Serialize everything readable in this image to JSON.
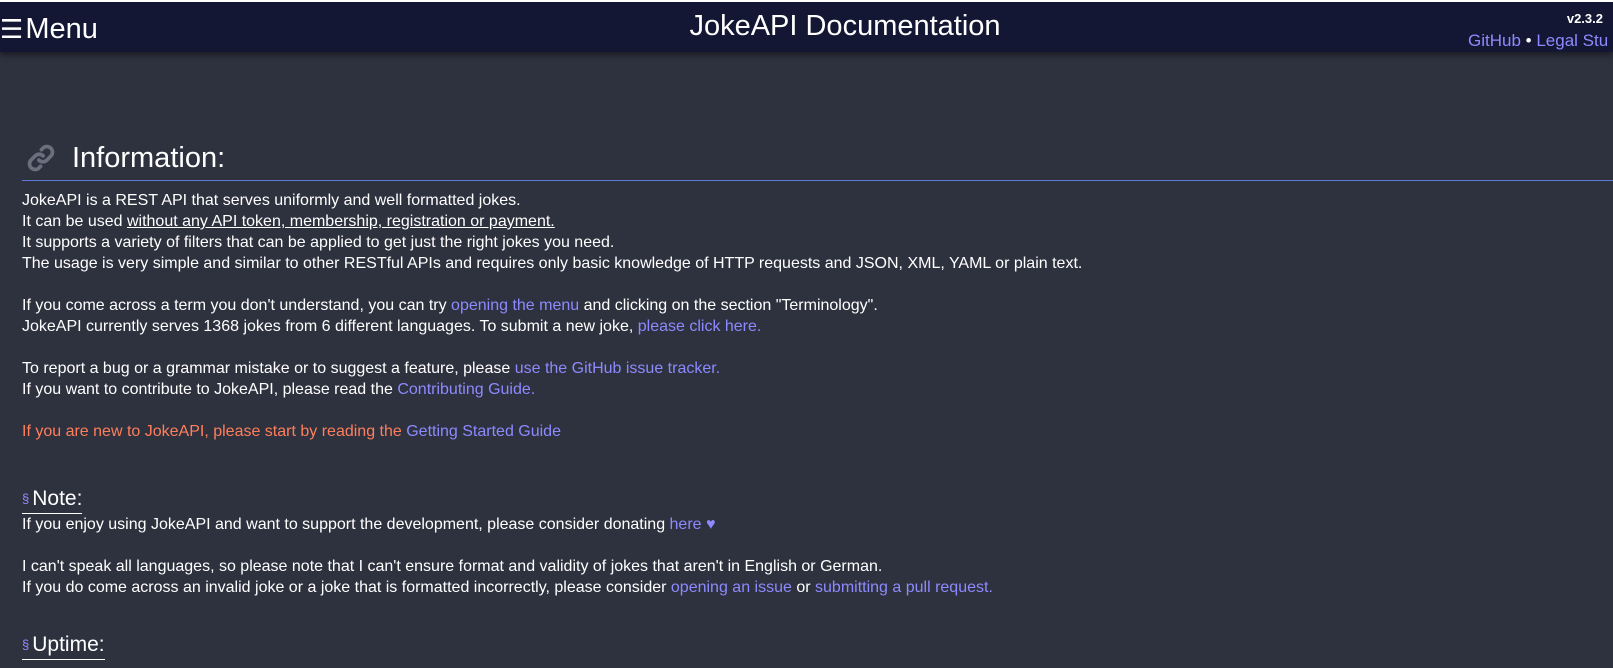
{
  "header": {
    "menu_icon": "☰",
    "menu_label": "Menu",
    "title": "JokeAPI Documentation",
    "version": "v2.3.2",
    "links": {
      "github": "GitHub",
      "separator": " • ",
      "legal": "Legal Stu"
    }
  },
  "information": {
    "title": "Information:",
    "icon": "link-icon",
    "lines": {
      "l1": "JokeAPI is a REST API that serves uniformly and well formatted jokes.",
      "l2_prefix": "It can be used ",
      "l2_underlined": "without any API token, membership, registration or payment.",
      "l3": "It supports a variety of filters that can be applied to get just the right jokes you need.",
      "l4": "The usage is very simple and similar to other RESTful APIs and requires only basic knowledge of HTTP requests and JSON, XML, YAML or plain text.",
      "l5_prefix": "If you come across a term you don't understand, you can try ",
      "l5_link": "opening the menu",
      "l5_suffix": " and clicking on the section \"Terminology\".",
      "l6_prefix": "JokeAPI currently serves 1368 jokes from 6 different languages. To submit a new joke, ",
      "l6_link": "please click here.",
      "l7_prefix": "To report a bug or a grammar mistake or to suggest a feature, please ",
      "l7_link": "use the GitHub issue tracker.",
      "l8_prefix": "If you want to contribute to JokeAPI, please read the ",
      "l8_link": "Contributing Guide.",
      "l9_prefix": "If you are new to JokeAPI, please start by reading the ",
      "l9_link": "Getting Started Guide"
    }
  },
  "note": {
    "section_mark": "§",
    "title": "Note:",
    "l1_prefix": "If you enjoy using JokeAPI and want to support the development, please consider donating ",
    "l1_link": "here ♥",
    "l2": "I can't speak all languages, so please note that I can't ensure format and validity of jokes that aren't in English or German.",
    "l3_prefix": "If you do come across an invalid joke or a joke that is formatted incorrectly, please consider ",
    "l3_link1": "opening an issue",
    "l3_mid": " or ",
    "l3_link2": "submitting a pull request."
  },
  "uptime": {
    "section_mark": "§",
    "title": "Uptime:"
  },
  "colors": {
    "background": "#2e313e",
    "header": "#141733",
    "link": "#8d8aff",
    "highlight": "#ff7f5c",
    "divider": "#5d7bd6"
  }
}
